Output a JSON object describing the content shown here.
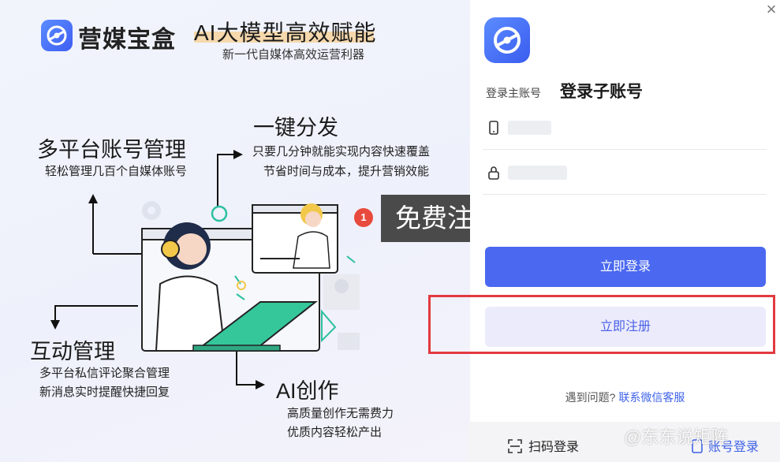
{
  "brand": {
    "name": "营媒宝盒",
    "slogan": "AI大模型高效赋能",
    "slogan_sub": "新一代自媒体高效运营利器"
  },
  "features": {
    "multi_account": {
      "title": "多平台账号管理",
      "desc": "轻松管理几百个自媒体账号"
    },
    "one_click": {
      "title": "一键分发",
      "desc_1": "只要几分钟就能实现内容快速覆盖",
      "desc_2": "节省时间与成本，提升营销效能"
    },
    "interaction": {
      "title": "互动管理",
      "desc_1": "多平台私信评论聚合管理",
      "desc_2": "新消息实时提醒快捷回复"
    },
    "ai_create": {
      "title": "AI创作",
      "desc_1": "高质量创作无需费力",
      "desc_2": "优质内容轻松产出"
    }
  },
  "tooltip": {
    "badge": "1",
    "text": "免费注册使用"
  },
  "login": {
    "close": "×",
    "tab_main": "登录主账号",
    "tab_sub": "登录子账号",
    "login_button": "立即登录",
    "register_button": "立即注册",
    "help_text": "遇到问题?",
    "help_link": "联系微信客服",
    "qr_login": "扫码登录",
    "account_login": "账号登录"
  },
  "watermark": "@东东说矩阵",
  "colors": {
    "accent": "#4a68f0",
    "highlight": "#e23a40",
    "badge": "#e84a3d"
  }
}
